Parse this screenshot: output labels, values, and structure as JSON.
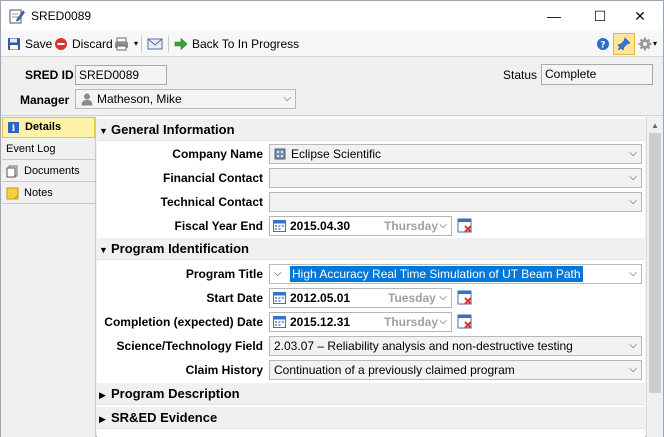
{
  "window": {
    "title": "SRED0089",
    "minimize": "—",
    "maximize": "☐",
    "close": "✕"
  },
  "toolbar": {
    "save_label": "Save",
    "discard_label": "Discard",
    "back_label": "Back To In Progress"
  },
  "header": {
    "sred_id_label": "SRED ID",
    "sred_id_value": "SRED0089",
    "status_label": "Status",
    "status_value": "Complete",
    "manager_label": "Manager",
    "manager_value": "Matheson, Mike"
  },
  "nav": {
    "items": [
      {
        "label": "Details"
      },
      {
        "label": "Event Log"
      },
      {
        "label": "Documents"
      },
      {
        "label": "Notes"
      }
    ]
  },
  "sections": {
    "general": "General Information",
    "program_id": "Program Identification",
    "program_desc": "Program Description",
    "evidence": "SR&ED Evidence"
  },
  "fields": {
    "company_name_label": "Company Name",
    "company_name_value": "Eclipse Scientific",
    "financial_contact_label": "Financial Contact",
    "financial_contact_value": "",
    "technical_contact_label": "Technical Contact",
    "technical_contact_value": "",
    "fiscal_year_end_label": "Fiscal Year End",
    "fiscal_year_end_value": "2015.04.30",
    "fiscal_year_end_dow": "Thursday",
    "program_title_label": "Program Title",
    "program_title_value": "High Accuracy Real Time Simulation of UT Beam Path",
    "start_date_label": "Start Date",
    "start_date_value": "2012.05.01",
    "start_date_dow": "Tuesday",
    "completion_label": "Completion (expected) Date",
    "completion_value": "2015.12.31",
    "completion_dow": "Thursday",
    "science_field_label": "Science/Technology Field",
    "science_field_value": "2.03.07 – Reliability analysis and non-destructive testing",
    "claim_history_label": "Claim History",
    "claim_history_value": "Continuation of a previously claimed program"
  },
  "colors": {
    "nav_active": "#fff2a8",
    "selection": "#0078d7"
  }
}
